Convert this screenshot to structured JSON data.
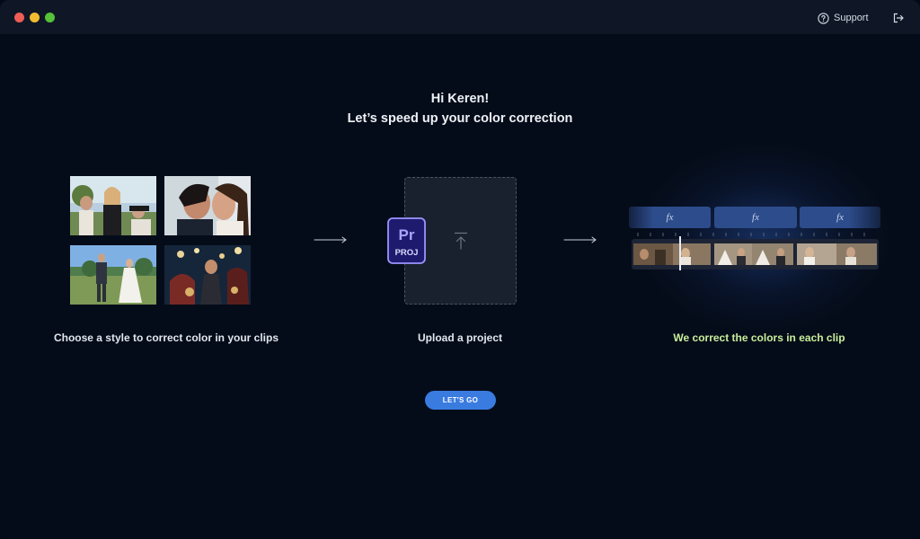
{
  "titlebar": {
    "support_label": "Support",
    "support_icon": "help-circle-icon",
    "logout_icon": "logout-icon"
  },
  "greeting": {
    "line1": "Hi Keren!",
    "line2": "Let’s speed up your color correction"
  },
  "steps": [
    {
      "caption": "Choose a style to correct color in your clips"
    },
    {
      "caption": "Upload a project",
      "badge_app": "Pr",
      "badge_ext": "PROJ"
    },
    {
      "caption": "We correct the colors in each clip"
    }
  ],
  "timeline": {
    "effect_labels": [
      "fx",
      "fx",
      "fx"
    ]
  },
  "cta": {
    "label": "LET'S GO"
  },
  "colors": {
    "accent": "#3a7be0",
    "highlight_caption": "#c8ee9b",
    "fx_bar": "#2d4c8b",
    "background": "#050c19"
  }
}
